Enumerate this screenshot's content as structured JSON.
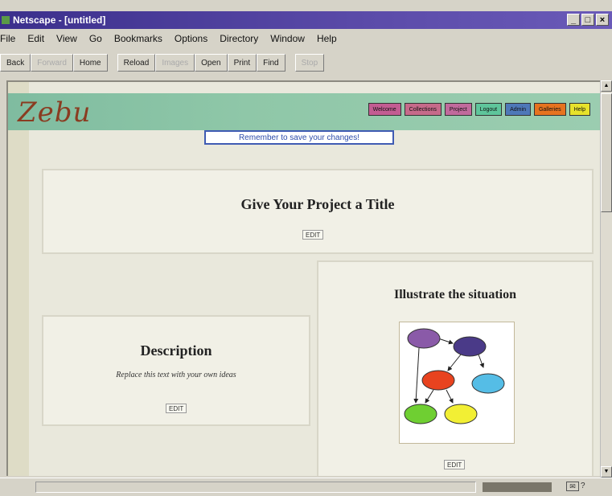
{
  "window": {
    "title": "Netscape - [untitled]",
    "controls": [
      "_",
      "□",
      "×"
    ]
  },
  "menu": [
    "File",
    "Edit",
    "View",
    "Go",
    "Bookmarks",
    "Options",
    "Directory",
    "Window",
    "Help"
  ],
  "toolbar": {
    "back": "Back",
    "forward": "Forward",
    "home": "Home",
    "reload": "Reload",
    "images": "Images",
    "open": "Open",
    "print": "Print",
    "find": "Find",
    "stop": "Stop"
  },
  "page": {
    "logo": "Zebu",
    "nav": [
      {
        "label": "Welcome",
        "color": "#c35c92"
      },
      {
        "label": "Collections",
        "color": "#c66a8a"
      },
      {
        "label": "Project",
        "color": "#c16a9c"
      },
      {
        "label": "Logout",
        "color": "#5ec59b"
      },
      {
        "label": "Admin",
        "color": "#4e78b8"
      },
      {
        "label": "Galleries",
        "color": "#e6731f"
      },
      {
        "label": "Help",
        "color": "#e7e22b"
      }
    ],
    "reminder": "Remember to save your changes!",
    "title_panel": {
      "heading": "Give Your Project a Title",
      "edit": "EDIT"
    },
    "description_panel": {
      "heading": "Description",
      "placeholder": "Replace this text with your own ideas",
      "edit": "EDIT"
    },
    "illustrate_panel": {
      "heading": "Illustrate the situation",
      "edit": "EDIT"
    }
  },
  "status": {
    "count": "?"
  }
}
